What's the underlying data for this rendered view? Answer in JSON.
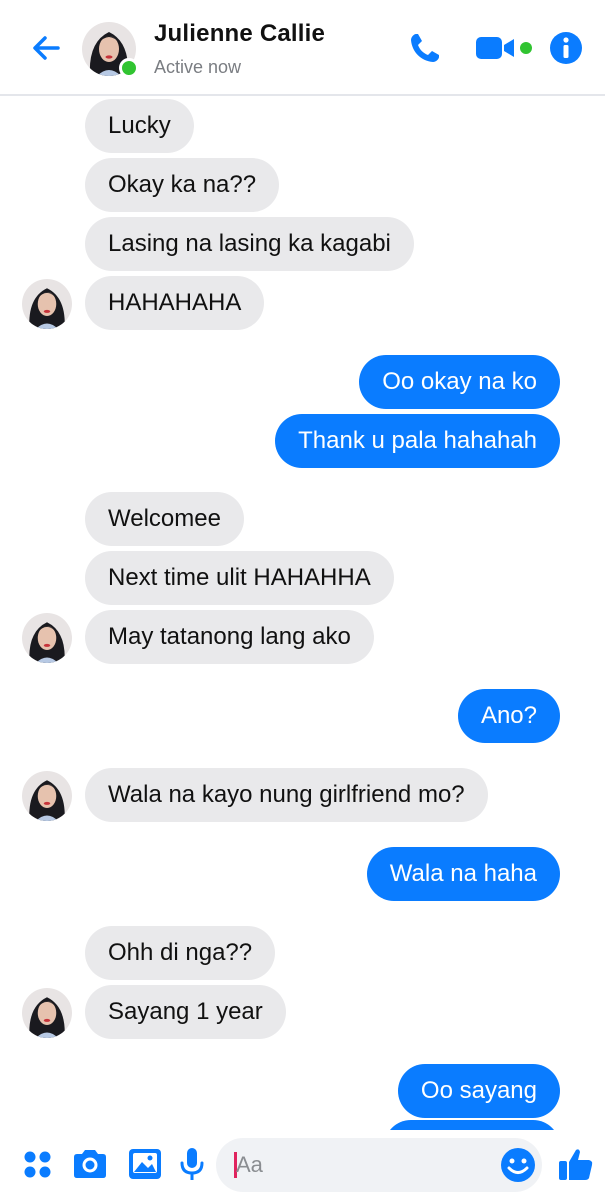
{
  "header": {
    "contact_name": "Julienne Callie",
    "status": "Active now",
    "icons": [
      "back-arrow-icon",
      "phone-icon",
      "video-camera-icon",
      "info-icon"
    ]
  },
  "messages": [
    {
      "from": "them",
      "text": "Lucky"
    },
    {
      "from": "them",
      "text": "Okay ka na??"
    },
    {
      "from": "them",
      "text": "Lasing na lasing ka kagabi"
    },
    {
      "from": "them",
      "text": "HAHAHAHA"
    },
    {
      "from": "me",
      "text": "Oo okay na ko"
    },
    {
      "from": "me",
      "text": "Thank u pala hahahah"
    },
    {
      "from": "them",
      "text": "Welcomee"
    },
    {
      "from": "them",
      "text": "Next time ulit HAHAHHA"
    },
    {
      "from": "them",
      "text": "May tatanong lang ako"
    },
    {
      "from": "me",
      "text": "Ano?"
    },
    {
      "from": "them",
      "text": "Wala na kayo nung girlfriend mo?"
    },
    {
      "from": "me",
      "text": "Wala na haha"
    },
    {
      "from": "them",
      "text": "Ohh di nga??"
    },
    {
      "from": "them",
      "text": "Sayang 1 year"
    },
    {
      "from": "me",
      "text": "Oo sayang"
    }
  ],
  "composer": {
    "placeholder": "Aa",
    "icons": [
      "apps-grid-icon",
      "camera-icon",
      "gallery-icon",
      "microphone-icon",
      "emoji-icon",
      "thumbs-up-icon"
    ]
  },
  "colors": {
    "accent": "#0a7cff",
    "incoming_bubble": "#e9e9eb",
    "online": "#31c431"
  }
}
